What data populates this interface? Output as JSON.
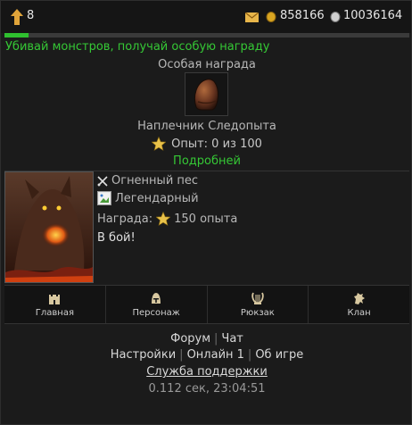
{
  "header": {
    "level": "8",
    "gold": "858166",
    "silver": "10036164",
    "xp_progress_fraction": 0.06
  },
  "quest": {
    "title": "Убивай монстров, получай особую награду",
    "reward_heading": "Особая награда",
    "item_name": "Наплечник Следопыта",
    "xp_text": "Опыт: 0 из 100",
    "more_link": "Подробней"
  },
  "monster": {
    "name": "Огненный пес",
    "rarity": "Легендарный",
    "reward_label": "Награда:",
    "reward_value": "150 опыта",
    "fight_link": "В бой!"
  },
  "nav": {
    "items": [
      {
        "label": "Главная",
        "icon": "castle-icon"
      },
      {
        "label": "Персонаж",
        "icon": "helmet-icon"
      },
      {
        "label": "Рюкзак",
        "icon": "lyre-icon"
      },
      {
        "label": "Клан",
        "icon": "lion-icon"
      }
    ]
  },
  "footer": {
    "forum": "Форум",
    "chat": "Чат",
    "settings": "Настройки",
    "online": "Онлайн 1",
    "about": "Об игре",
    "support": "Служба поддержки",
    "timing": "0.112 сек, 23:04:51"
  },
  "colors": {
    "accent_green": "#35c835",
    "xp_bar": "#2fbf2f",
    "background": "#1b1b1b"
  }
}
